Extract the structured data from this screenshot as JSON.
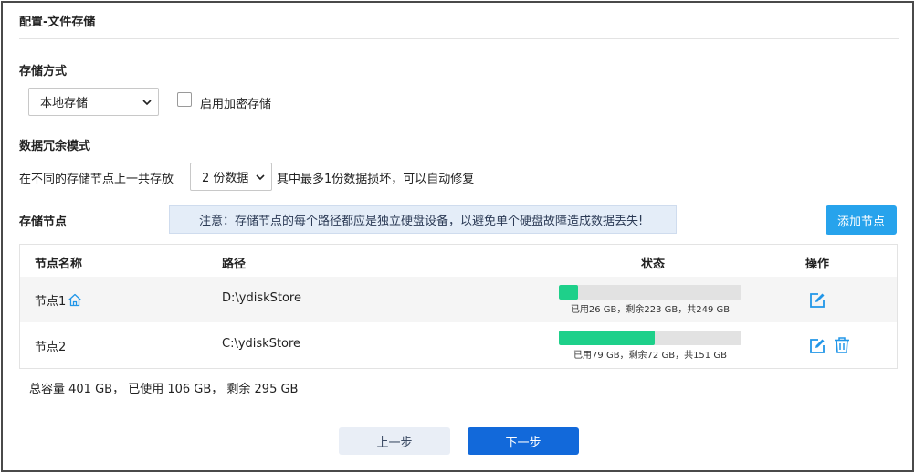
{
  "page": {
    "title": "配置-文件存储"
  },
  "storage_mode": {
    "label": "存储方式",
    "select_value": "本地存储",
    "encrypt_label": "启用加密存储",
    "encrypt_checked": false
  },
  "redundancy": {
    "label": "数据冗余模式",
    "prefix": "在不同的存储节点上一共存放",
    "select_value": "2 份数据",
    "suffix": "其中最多1份数据损坏，可以自动修复"
  },
  "nodes": {
    "label": "存储节点",
    "notice": "注意：存储节点的每个路径都应是独立硬盘设备，以避免单个硬盘故障造成数据丢失!",
    "add_button": "添加节点",
    "columns": [
      "节点名称",
      "路径",
      "状态",
      "操作"
    ],
    "rows": [
      {
        "name": "节点1",
        "is_home": true,
        "path": "D:\\ydiskStore",
        "usage_fraction": 0.104,
        "status": "已用26 GB，剩余223 GB，共249 GB",
        "can_delete": false
      },
      {
        "name": "节点2",
        "is_home": false,
        "path": "C:\\ydiskStore",
        "usage_fraction": 0.523,
        "status": "已用79 GB，剩余72 GB，共151 GB",
        "can_delete": true
      }
    ]
  },
  "summary": "总容量 401 GB， 已使用 106 GB， 剩余 295 GB",
  "buttons": {
    "prev": "上一步",
    "next": "下一步"
  },
  "colors": {
    "accent": "#1269da",
    "add_button": "#27a3ec",
    "usage_fill": "#1ed08a",
    "icon_blue": "#2196e8"
  }
}
